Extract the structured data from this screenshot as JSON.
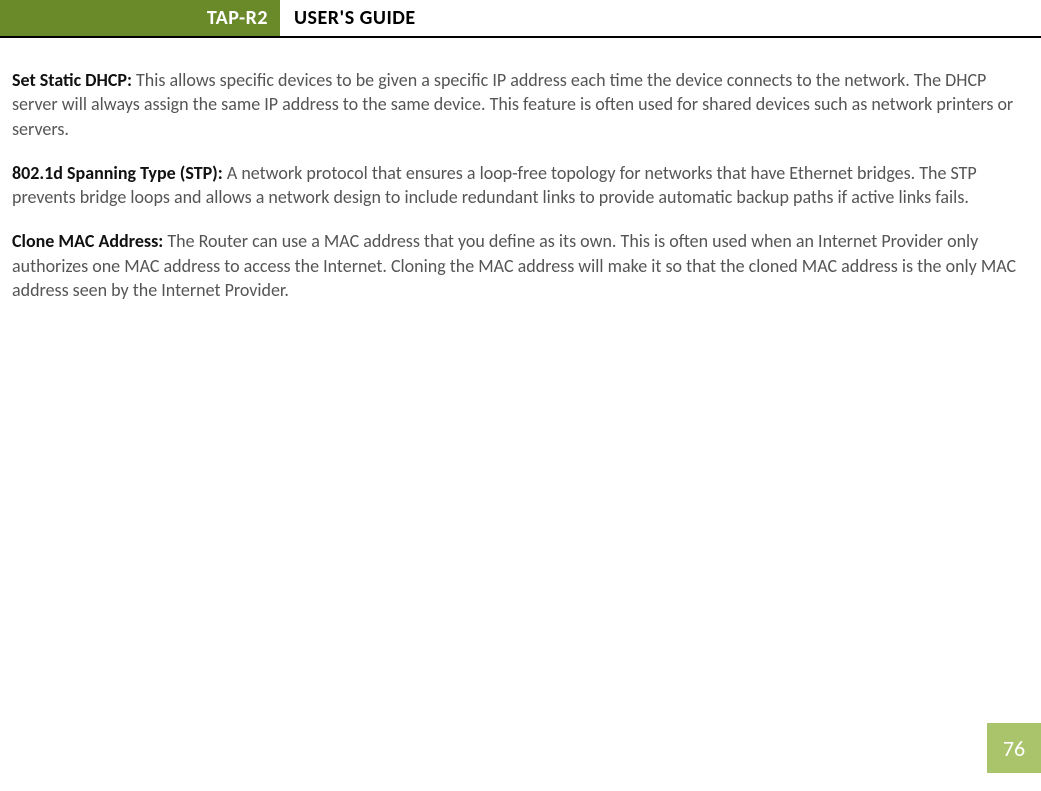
{
  "header": {
    "badge": "TAP-R2",
    "title": "USER'S GUIDE"
  },
  "sections": [
    {
      "heading": "Set Static DHCP:",
      "body": " This allows specific devices to be given a specific IP address each time the device connects to the network. The DHCP server will always assign the same IP address to the same device. This feature is often used for shared devices such as network printers or servers."
    },
    {
      "heading": "802.1d Spanning Type (STP):",
      "body": " A network protocol that ensures a loop-free topology for networks that have Ethernet bridges. The STP prevents bridge loops and allows a network design to include redundant links to provide automatic backup paths if active links fails."
    },
    {
      "heading": "Clone MAC Address:",
      "body": " The Router can use a MAC address that you define as its own. This is often used when an Internet Provider only authorizes one MAC address to access the Internet. Cloning the MAC address will make it so that the cloned MAC address is the only MAC address seen by the Internet Provider."
    }
  ],
  "page_number": "76"
}
